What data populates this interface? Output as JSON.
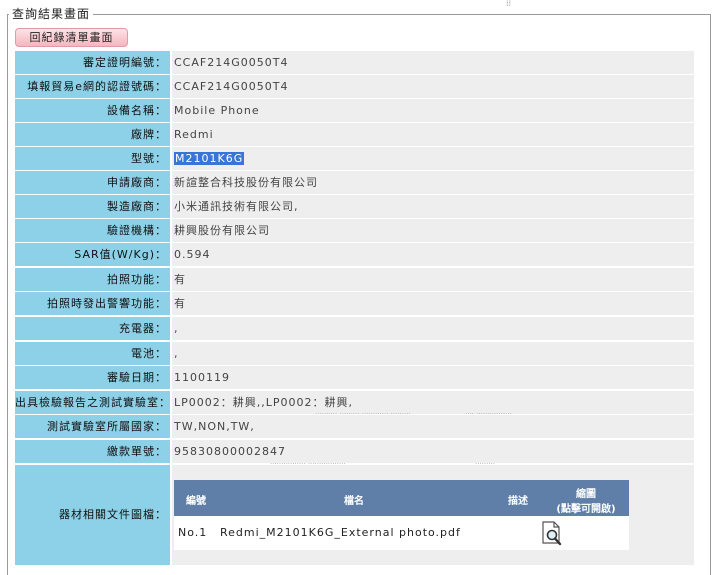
{
  "panel": {
    "legend": "查詢結果畫面",
    "back_button": "回紀錄清單畫面"
  },
  "fields": [
    {
      "label": "審定證明編號：",
      "value": "CCAF214G0050T4"
    },
    {
      "label": "填報貿易e網的認證號碼：",
      "value": "CCAF214G0050T4"
    },
    {
      "label": "設備名稱：",
      "value": "Mobile Phone"
    },
    {
      "label": "廠牌：",
      "value": "Redmi"
    },
    {
      "label": "型號：",
      "value": "M2101K6G"
    },
    {
      "label": "申請廠商：",
      "value": "新諠整合科技股份有限公司"
    },
    {
      "label": "製造廠商：",
      "value": "小米通訊技術有限公司,"
    },
    {
      "label": "驗證機構：",
      "value": "耕興股份有限公司"
    },
    {
      "label": "SAR值(W/Kg)：",
      "value": "0.594"
    },
    {
      "label": "拍照功能：",
      "value": "有"
    },
    {
      "label": "拍照時發出警響功能：",
      "value": "有"
    },
    {
      "label": "充電器：",
      "value": ","
    },
    {
      "label": "電池：",
      "value": ","
    },
    {
      "label": "審驗日期：",
      "value": "1100119"
    },
    {
      "label": "出具檢驗報告之測試實驗室：",
      "value": "LP0002：耕興,,LP0002：耕興,"
    },
    {
      "label": "測試實驗室所屬國家：",
      "value": "TW,NON,TW,"
    },
    {
      "label": "繳款單號：",
      "value": "95830800002847"
    }
  ],
  "documents": {
    "label": "器材相關文件圖檔：",
    "headers": {
      "number": "編號",
      "name": "檔名",
      "description": "描述",
      "thumbnail_line1": "縮圖",
      "thumbnail_line2": "(點擊可開啟)"
    },
    "rows": [
      {
        "number": "No.1",
        "name": "Redmi_M2101K6G_External photo.pdf",
        "description": "",
        "thumbnail_icon": "document-magnifier-icon"
      }
    ]
  }
}
